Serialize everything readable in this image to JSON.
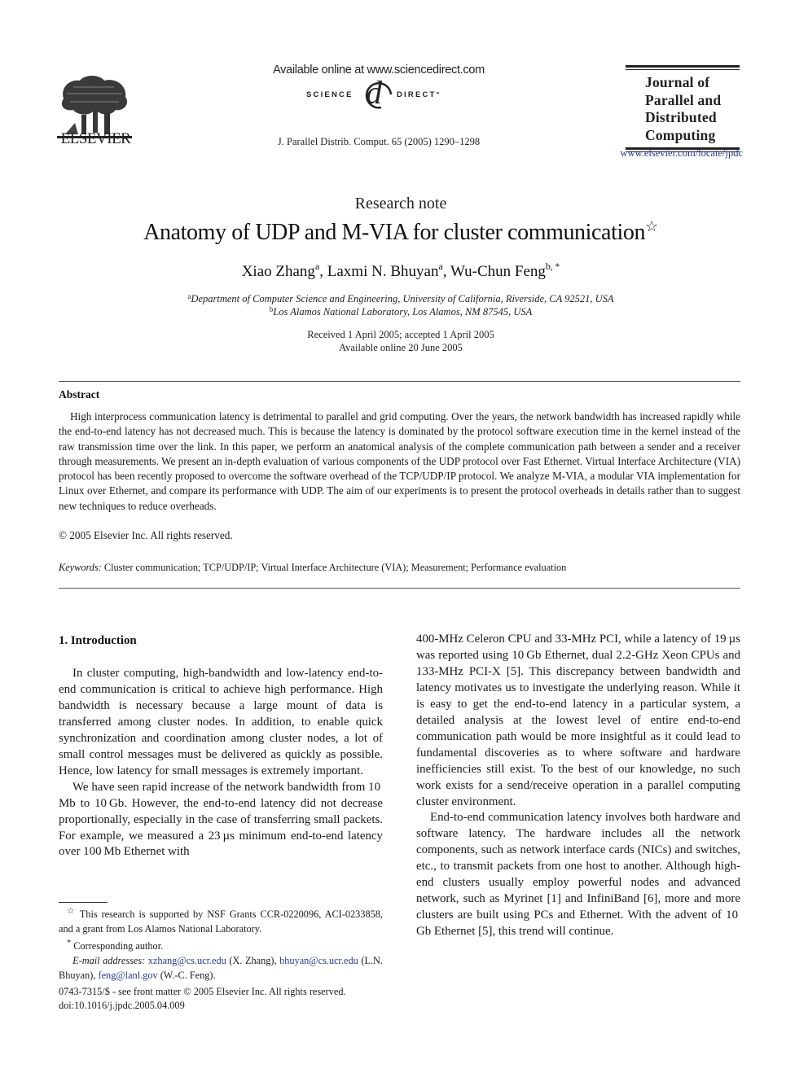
{
  "header": {
    "publisher_name": "ELSEVIER",
    "available_online": "Available online at www.sciencedirect.com",
    "sciencedirect_left": "SCIENCE",
    "sciencedirect_at": "d",
    "sciencedirect_right": "DIRECT°",
    "citation": "J. Parallel Distrib. Comput. 65 (2005) 1290–1298",
    "journal_title_lines": [
      "Journal of",
      "Parallel and",
      "Distributed",
      "Computing"
    ],
    "journal_url": "www.elsevier.com/locate/jpdc"
  },
  "article": {
    "type": "Research note",
    "title": "Anatomy of UDP and M-VIA for cluster communication",
    "title_mark": "☆",
    "authors": [
      {
        "name": "Xiao Zhang",
        "sup": "a",
        "sep": ", "
      },
      {
        "name": "Laxmi N. Bhuyan",
        "sup": "a",
        "sep": ", "
      },
      {
        "name": "Wu-Chun Feng",
        "sup": "b, *",
        "sep": ""
      }
    ],
    "affiliations": [
      {
        "mark": "a",
        "text": "Department of Computer Science and Engineering, University of California, Riverside, CA 92521, USA"
      },
      {
        "mark": "b",
        "text": "Los Alamos National Laboratory, Los Alamos, NM 87545, USA"
      }
    ],
    "received": "Received 1 April 2005; accepted 1 April 2005",
    "available_online_date": "Available online 20 June 2005"
  },
  "abstract": {
    "heading": "Abstract",
    "body": "High interprocess communication latency is detrimental to parallel and grid computing. Over the years, the network bandwidth has increased rapidly while the end-to-end latency has not decreased much. This is because the latency is dominated by the protocol software execution time in the kernel instead of the raw transmission time over the link. In this paper, we perform an anatomical analysis of the complete communication path between a sender and a receiver through measurements. We present an in-depth evaluation of various components of the UDP protocol over Fast Ethernet. Virtual Interface Architecture (VIA) protocol has been recently proposed to overcome the software overhead of the TCP/UDP/IP protocol. We analyze M-VIA, a modular VIA implementation for Linux over Ethernet, and compare its performance with UDP. The aim of our experiments is to present the protocol overheads in details rather than to suggest new techniques to reduce overheads.",
    "copyright": "© 2005 Elsevier Inc. All rights reserved.",
    "keywords_label": "Keywords:",
    "keywords": "Cluster communication; TCP/UDP/IP; Virtual Interface Architecture (VIA); Measurement; Performance evaluation"
  },
  "section": {
    "heading": "1.  Introduction",
    "left_paragraphs": [
      "In cluster computing, high-bandwidth and low-latency end-to-end communication is critical to achieve high performance. High bandwidth is necessary because a large mount of data is transferred among cluster nodes. In addition, to enable quick synchronization and coordination among cluster nodes, a lot of small control messages must be delivered as quickly as possible. Hence, low latency for small messages is extremely important.",
      "We have seen rapid increase of the network bandwidth from 10 Mb to 10 Gb. However, the end-to-end latency did not decrease proportionally, especially in the case of transferring small packets. For example, we measured a 23 µs minimum end-to-end latency over 100 Mb Ethernet with"
    ],
    "right_paragraphs": [
      "400-MHz Celeron CPU and 33-MHz PCI, while a latency of 19 µs was reported using 10 Gb Ethernet, dual 2.2-GHz Xeon CPUs and 133-MHz PCI-X [5]. This discrepancy between bandwidth and latency motivates us to investigate the underlying reason. While it is easy to get the end-to-end latency in a particular system, a detailed analysis at the lowest level of entire end-to-end communication path would be more insightful as it could lead to fundamental discoveries as to where software and hardware inefficiencies still exist. To the best of our knowledge, no such work exists for a send/receive operation in a parallel computing cluster environment.",
      "End-to-end communication latency involves both hardware and software latency. The hardware includes all the network components, such as network interface cards (NICs) and switches, etc., to transmit packets from one host to another. Although high-end clusters usually employ powerful nodes and advanced network, such as Myrinet [1] and InfiniBand [6], more and more clusters are built using PCs and Ethernet. With the advent of 10 Gb Ethernet [5], this trend will continue."
    ]
  },
  "footnotes": {
    "star_mark": "☆",
    "funding": "This research is supported by NSF Grants CCR-0220096, ACI-0233858, and a grant from Los Alamos National Laboratory.",
    "corresponding_mark": "*",
    "corresponding": "Corresponding author.",
    "email_label": "E-mail addresses:",
    "emails": [
      {
        "address": "xzhang@cs.ucr.edu",
        "who": " (X. Zhang), "
      },
      {
        "address": "bhuyan@cs.ucr.edu",
        "who": " (L.N. Bhuyan), "
      },
      {
        "address": "feng@lanl.gov",
        "who": " (W.-C. Feng)."
      }
    ],
    "issn_line": "0743-7315/$ - see front matter © 2005 Elsevier Inc. All rights reserved.",
    "doi": "doi:10.1016/j.jpdc.2005.04.009"
  },
  "colors": {
    "link": "#2a3a8a",
    "text": "#1a1a1a"
  }
}
